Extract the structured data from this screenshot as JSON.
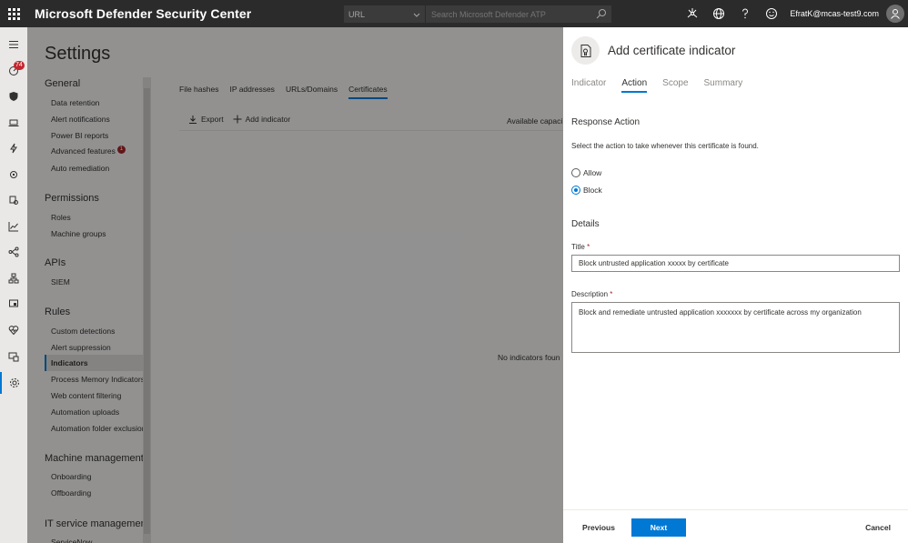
{
  "app": {
    "title": "Microsoft Defender Security Center",
    "search_scope": "URL",
    "search_placeholder": "Search Microsoft Defender ATP",
    "user": "EfratK@mcas-test9.com"
  },
  "rail": {
    "badge_count": "74",
    "icons": [
      "menu-icon",
      "dashboard-icon",
      "shield-icon",
      "laptop-icon",
      "lightning-icon",
      "bug-icon",
      "partners-icon",
      "chart-icon",
      "share-icon",
      "org-icon",
      "device-health-icon",
      "heart-icon",
      "eval-icon",
      "settings-gear-icon"
    ]
  },
  "settings": {
    "title": "Settings",
    "sections": [
      {
        "label": "General",
        "items": [
          "Data retention",
          "Alert notifications",
          "Power BI reports",
          "Advanced features",
          "Auto remediation"
        ]
      },
      {
        "label": "Permissions",
        "items": [
          "Roles",
          "Machine groups"
        ]
      },
      {
        "label": "APIs",
        "items": [
          "SIEM"
        ]
      },
      {
        "label": "Rules",
        "items": [
          "Custom detections",
          "Alert suppression",
          "Indicators",
          "Process Memory Indicators",
          "Web content filtering",
          "Automation uploads",
          "Automation folder exclusions"
        ]
      },
      {
        "label": "Machine management",
        "items": [
          "Onboarding",
          "Offboarding"
        ]
      },
      {
        "label": "IT service management",
        "items": [
          "ServiceNow"
        ]
      }
    ],
    "advanced_badge": "1",
    "active_item": "Indicators"
  },
  "main": {
    "tabs": [
      "File hashes",
      "IP addresses",
      "URLs/Domains",
      "Certificates"
    ],
    "active_tab": "Certificates",
    "export_label": "Export",
    "add_label": "Add indicator",
    "capacity_label": "Available capaci",
    "empty_label": "No indicators foun"
  },
  "panel": {
    "title": "Add certificate indicator",
    "tabs": [
      "Indicator",
      "Action",
      "Scope",
      "Summary"
    ],
    "active_tab": "Action",
    "response_heading": "Response Action",
    "response_help": "Select the action to take whenever this certificate is found.",
    "options": [
      {
        "label": "Allow",
        "checked": false
      },
      {
        "label": "Block",
        "checked": true
      }
    ],
    "details_heading": "Details",
    "title_label": "Title",
    "title_value": "Block untrusted application xxxxx by certificate",
    "description_label": "Description",
    "description_value": "Block and remediate untrusted application xxxxxxx by certificate across my organization",
    "required_mark": "*",
    "previous_label": "Previous",
    "next_label": "Next",
    "cancel_label": "Cancel"
  }
}
